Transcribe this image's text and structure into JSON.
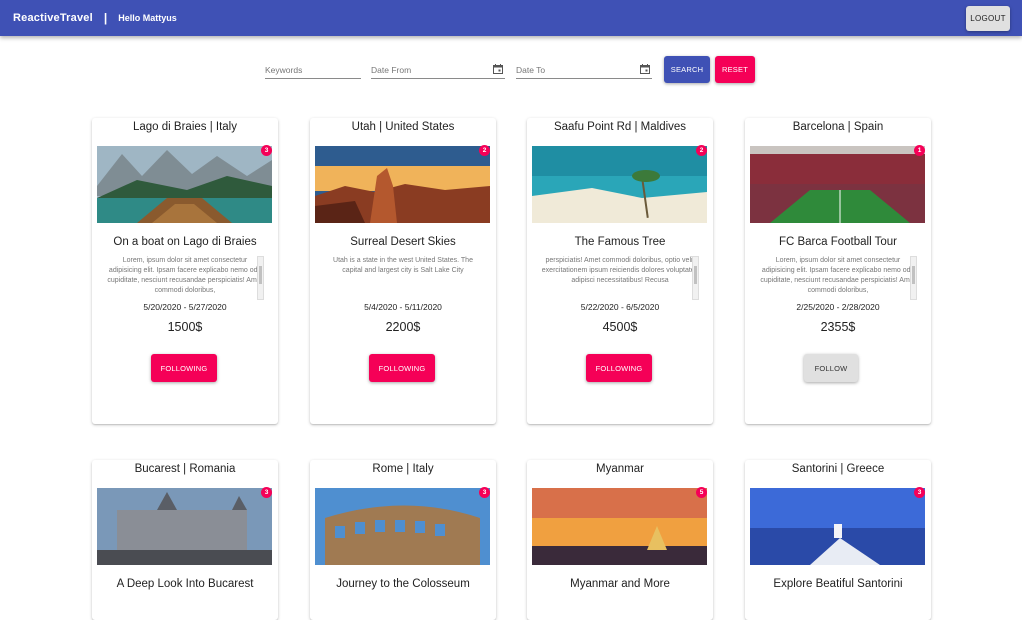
{
  "header": {
    "brand": "ReactiveTravel",
    "separator": "|",
    "greeting": "Hello Mattyus",
    "logout_label": "LOGOUT"
  },
  "search": {
    "keywords_placeholder": "Keywords",
    "date_from_placeholder": "Date From",
    "date_to_placeholder": "Date To",
    "search_label": "SEARCH",
    "reset_label": "RESET"
  },
  "colors": {
    "primary": "#3f51b5",
    "accent": "#f50057"
  },
  "trips": [
    {
      "location": "Lago di Braies | Italy",
      "badge": "3",
      "title": "On a boat on Lago di Braies",
      "description": "Lorem, ipsum dolor sit amet consectetur adipisicing elit. Ipsam facere explicabo nemo odit cupiditate, nesciunt recusandae perspiciatis! Amet commodi doloribus,",
      "dates": "5/20/2020 - 5/27/2020",
      "price": "1500$",
      "action": "FOLLOWING",
      "scrollable": true
    },
    {
      "location": "Utah | United States",
      "badge": "2",
      "title": "Surreal Desert Skies",
      "description": "Utah is a state in the west United States. The capital and largest city is Salt Lake City",
      "dates": "5/4/2020 - 5/11/2020",
      "price": "2200$",
      "action": "FOLLOWING",
      "scrollable": false
    },
    {
      "location": "Saafu Point Rd | Maldives",
      "badge": "2",
      "title": "The Famous Tree",
      "description": "perspiciatis! Amet commodi doloribus, optio velit exercitationem ipsum reiciendis dolores voluptates adipisci necessitatibus! Recusa",
      "dates": "5/22/2020 - 6/5/2020",
      "price": "4500$",
      "action": "FOLLOWING",
      "scrollable": true
    },
    {
      "location": "Barcelona | Spain",
      "badge": "1",
      "title": "FC Barca Football Tour",
      "description": "Lorem, ipsum dolor sit amet consectetur adipisicing elit. Ipsam facere explicabo nemo odit cupiditate, nesciunt recusandae perspiciatis! Amet commodi doloribus,",
      "dates": "2/25/2020 - 2/28/2020",
      "price": "2355$",
      "action": "FOLLOW",
      "scrollable": true
    },
    {
      "location": "Bucarest | Romania",
      "badge": "3",
      "title": "A Deep Look Into Bucarest"
    },
    {
      "location": "Rome | Italy",
      "badge": "3",
      "title": "Journey to the Colosseum"
    },
    {
      "location": "Myanmar",
      "badge": "5",
      "title": "Myanmar and More"
    },
    {
      "location": "Santorini | Greece",
      "badge": "3",
      "title": "Explore Beatiful Santorini"
    }
  ]
}
